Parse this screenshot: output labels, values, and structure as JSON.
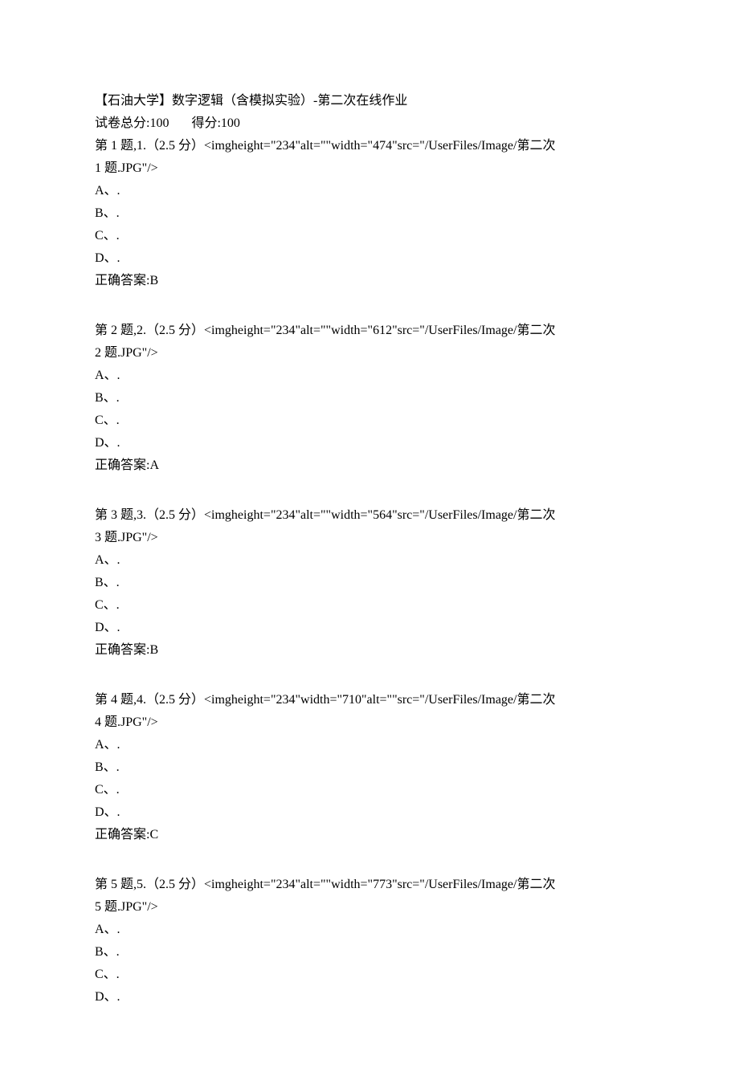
{
  "header": {
    "title": "【石油大学】数字逻辑（含模拟实验）-第二次在线作业",
    "score_line": "试卷总分:100       得分:100"
  },
  "questions": [
    {
      "prefix": "第 1 题,1.（2.5 分）",
      "img_tag": "<imgheight=\"234\"alt=\"\"width=\"474\"src=\"/UserFiles/Image/第二次",
      "img_tag_line2": "1 题.JPG\"/>",
      "options": [
        "A、.",
        "B、.",
        "C、.",
        "D、."
      ],
      "answer": "正确答案:B"
    },
    {
      "prefix": "第 2 题,2.（2.5 分）",
      "img_tag": "<imgheight=\"234\"alt=\"\"width=\"612\"src=\"/UserFiles/Image/第二次",
      "img_tag_line2": "2 题.JPG\"/>",
      "options": [
        "A、.",
        "B、.",
        "C、.",
        "D、."
      ],
      "answer": "正确答案:A"
    },
    {
      "prefix": "第 3 题,3.（2.5 分）",
      "img_tag": "<imgheight=\"234\"alt=\"\"width=\"564\"src=\"/UserFiles/Image/第二次",
      "img_tag_line2": "3 题.JPG\"/>",
      "options": [
        "A、.",
        "B、.",
        "C、.",
        "D、."
      ],
      "answer": "正确答案:B"
    },
    {
      "prefix": "第 4 题,4.（2.5 分）",
      "img_tag": "<imgheight=\"234\"width=\"710\"alt=\"\"src=\"/UserFiles/Image/第二次",
      "img_tag_line2": "4 题.JPG\"/>",
      "options": [
        "A、.",
        "B、.",
        "C、.",
        "D、."
      ],
      "answer": "正确答案:C"
    },
    {
      "prefix": "第 5 题,5.（2.5 分）",
      "img_tag": "<imgheight=\"234\"alt=\"\"width=\"773\"src=\"/UserFiles/Image/第二次",
      "img_tag_line2": "5 题.JPG\"/>",
      "options": [
        "A、.",
        "B、.",
        "C、.",
        "D、."
      ],
      "answer": null
    }
  ]
}
